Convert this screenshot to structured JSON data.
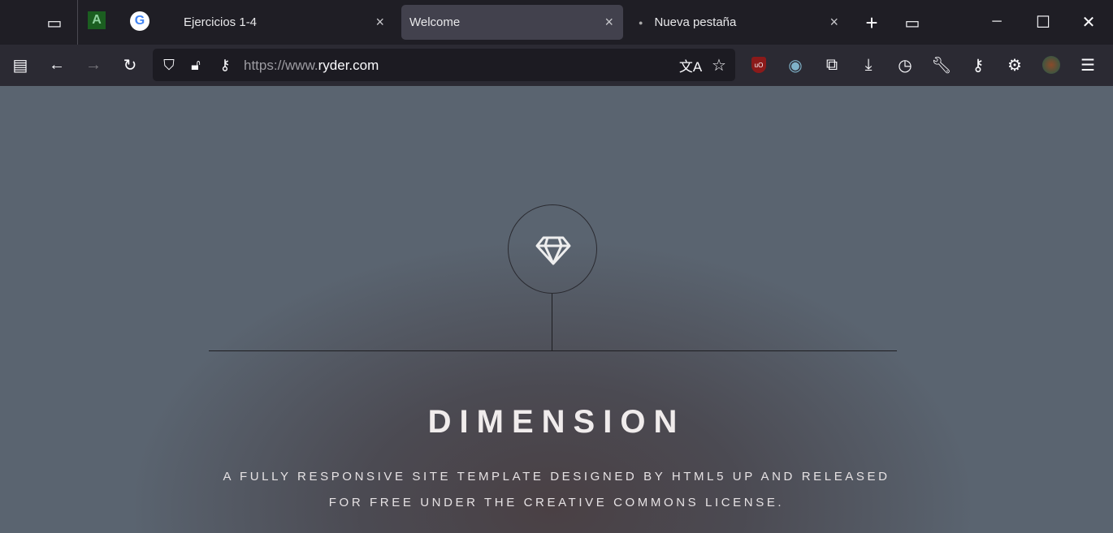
{
  "tabs": [
    {
      "label": "Ejercicios 1-4",
      "close": "×"
    },
    {
      "label": "Welcome",
      "close": "×",
      "active": true
    },
    {
      "label": "Nueva pestaña",
      "close": "×"
    }
  ],
  "new_tab": "+",
  "window": {
    "minimize": "─",
    "maximize": "☐",
    "close": "✕"
  },
  "address": {
    "prefix": "https://www.",
    "domain": "ryder.com"
  },
  "toolbar_icons": [
    "sidebar",
    "back",
    "forward",
    "reload",
    "shield",
    "lock-warning",
    "key",
    "translate",
    "bookmark-star",
    "ublock",
    "extension-mask",
    "extensions",
    "downloads",
    "history",
    "wrench",
    "passwords",
    "settings",
    "profile",
    "menu"
  ],
  "page": {
    "title": "DIMENSION",
    "subtitle_line1": "A FULLY RESPONSIVE SITE TEMPLATE DESIGNED BY HTML5 UP AND RELEASED",
    "subtitle_line2": "FOR FREE UNDER THE CREATIVE COMMONS LICENSE."
  },
  "colors": {
    "chrome": "#1f1e25",
    "toolbar": "#2b2a33",
    "active_tab": "#42414d"
  }
}
